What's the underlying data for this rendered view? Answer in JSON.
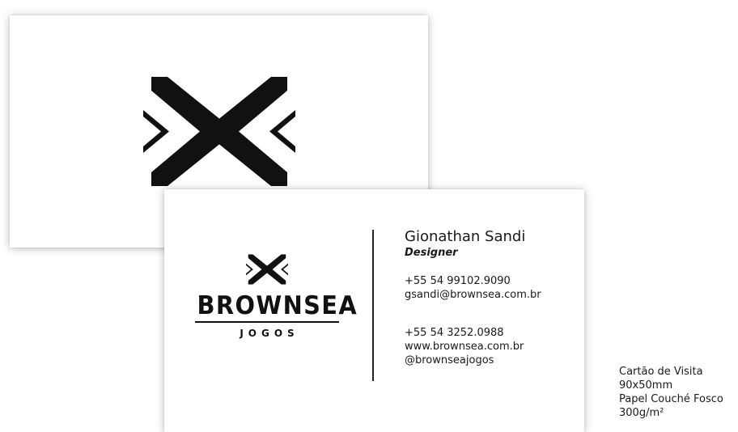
{
  "brand": {
    "name": "BROWNSEA",
    "sub": "JOGOS"
  },
  "contact": {
    "name": "Gionathan Sandi",
    "role": "Designer",
    "phone_mobile": "+55 54 99102.9090",
    "email": "gsandi@brownsea.com.br",
    "phone_office": "+55 54 3252.0988",
    "website": "www.brownsea.com.br",
    "social": "@brownseajogos"
  },
  "spec": {
    "line1": "Cartão de Visita",
    "line2": "90x50mm",
    "line3": "Papel Couché Fosco",
    "line4": "300g/m²"
  },
  "icons": {
    "logo_mark": "brownsea-mark-icon"
  },
  "colors": {
    "ink": "#111111",
    "card": "#ffffff"
  }
}
